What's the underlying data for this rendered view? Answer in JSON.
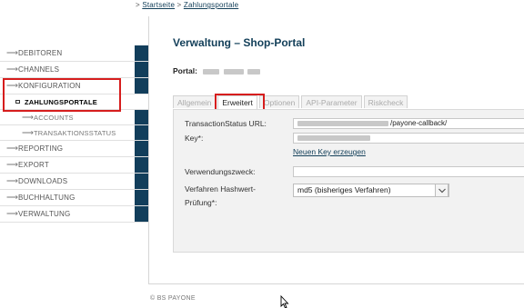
{
  "breadcrumb": {
    "separator1": ">",
    "home": "Startseite",
    "separator2": ">",
    "current": "Zahlungsportale"
  },
  "nav": {
    "arrow": "⟶",
    "items": [
      {
        "label": "DEBITOREN"
      },
      {
        "label": "CHANNELS"
      },
      {
        "label": "KONFIGURATION"
      },
      {
        "label": "ZAHLUNGSPORTALE"
      },
      {
        "label": "ACCOUNTS"
      },
      {
        "label": "TRANSAKTIONSSTATUS"
      },
      {
        "label": "REPORTING"
      },
      {
        "label": "EXPORT"
      },
      {
        "label": "DOWNLOADS"
      },
      {
        "label": "BUCHHALTUNG"
      },
      {
        "label": "VERWALTUNG"
      }
    ]
  },
  "page": {
    "title": "Verwaltung – Shop-Portal",
    "portal_label": "Portal:"
  },
  "tabs": [
    "Allgemein",
    "Erweitert",
    "Optionen",
    "API-Parameter",
    "Riskcheck"
  ],
  "form": {
    "status_url_label": "TransactionStatus URL:",
    "status_url_value": "/payone-callback/",
    "key_label": "Key*:",
    "new_key_link": "Neuen Key erzeugen",
    "purpose_label": "Verwendungszweck:",
    "purpose_value": "",
    "hash_label_1": "Verfahren Hashwert-",
    "hash_label_2": "Prüfung*:",
    "hash_value": "md5 (bisheriges Verfahren)"
  },
  "footer": {
    "text": "© BS PAYONE"
  },
  "colors": {
    "brand_dark": "#123e5b",
    "highlight": "#d61d1d"
  },
  "icons": {
    "nav_arrow": "arrow-right-icon",
    "nav_bullet": "square-bullet-icon",
    "select_caret": "chevron-down-icon",
    "pointer": "mouse-cursor-icon"
  }
}
